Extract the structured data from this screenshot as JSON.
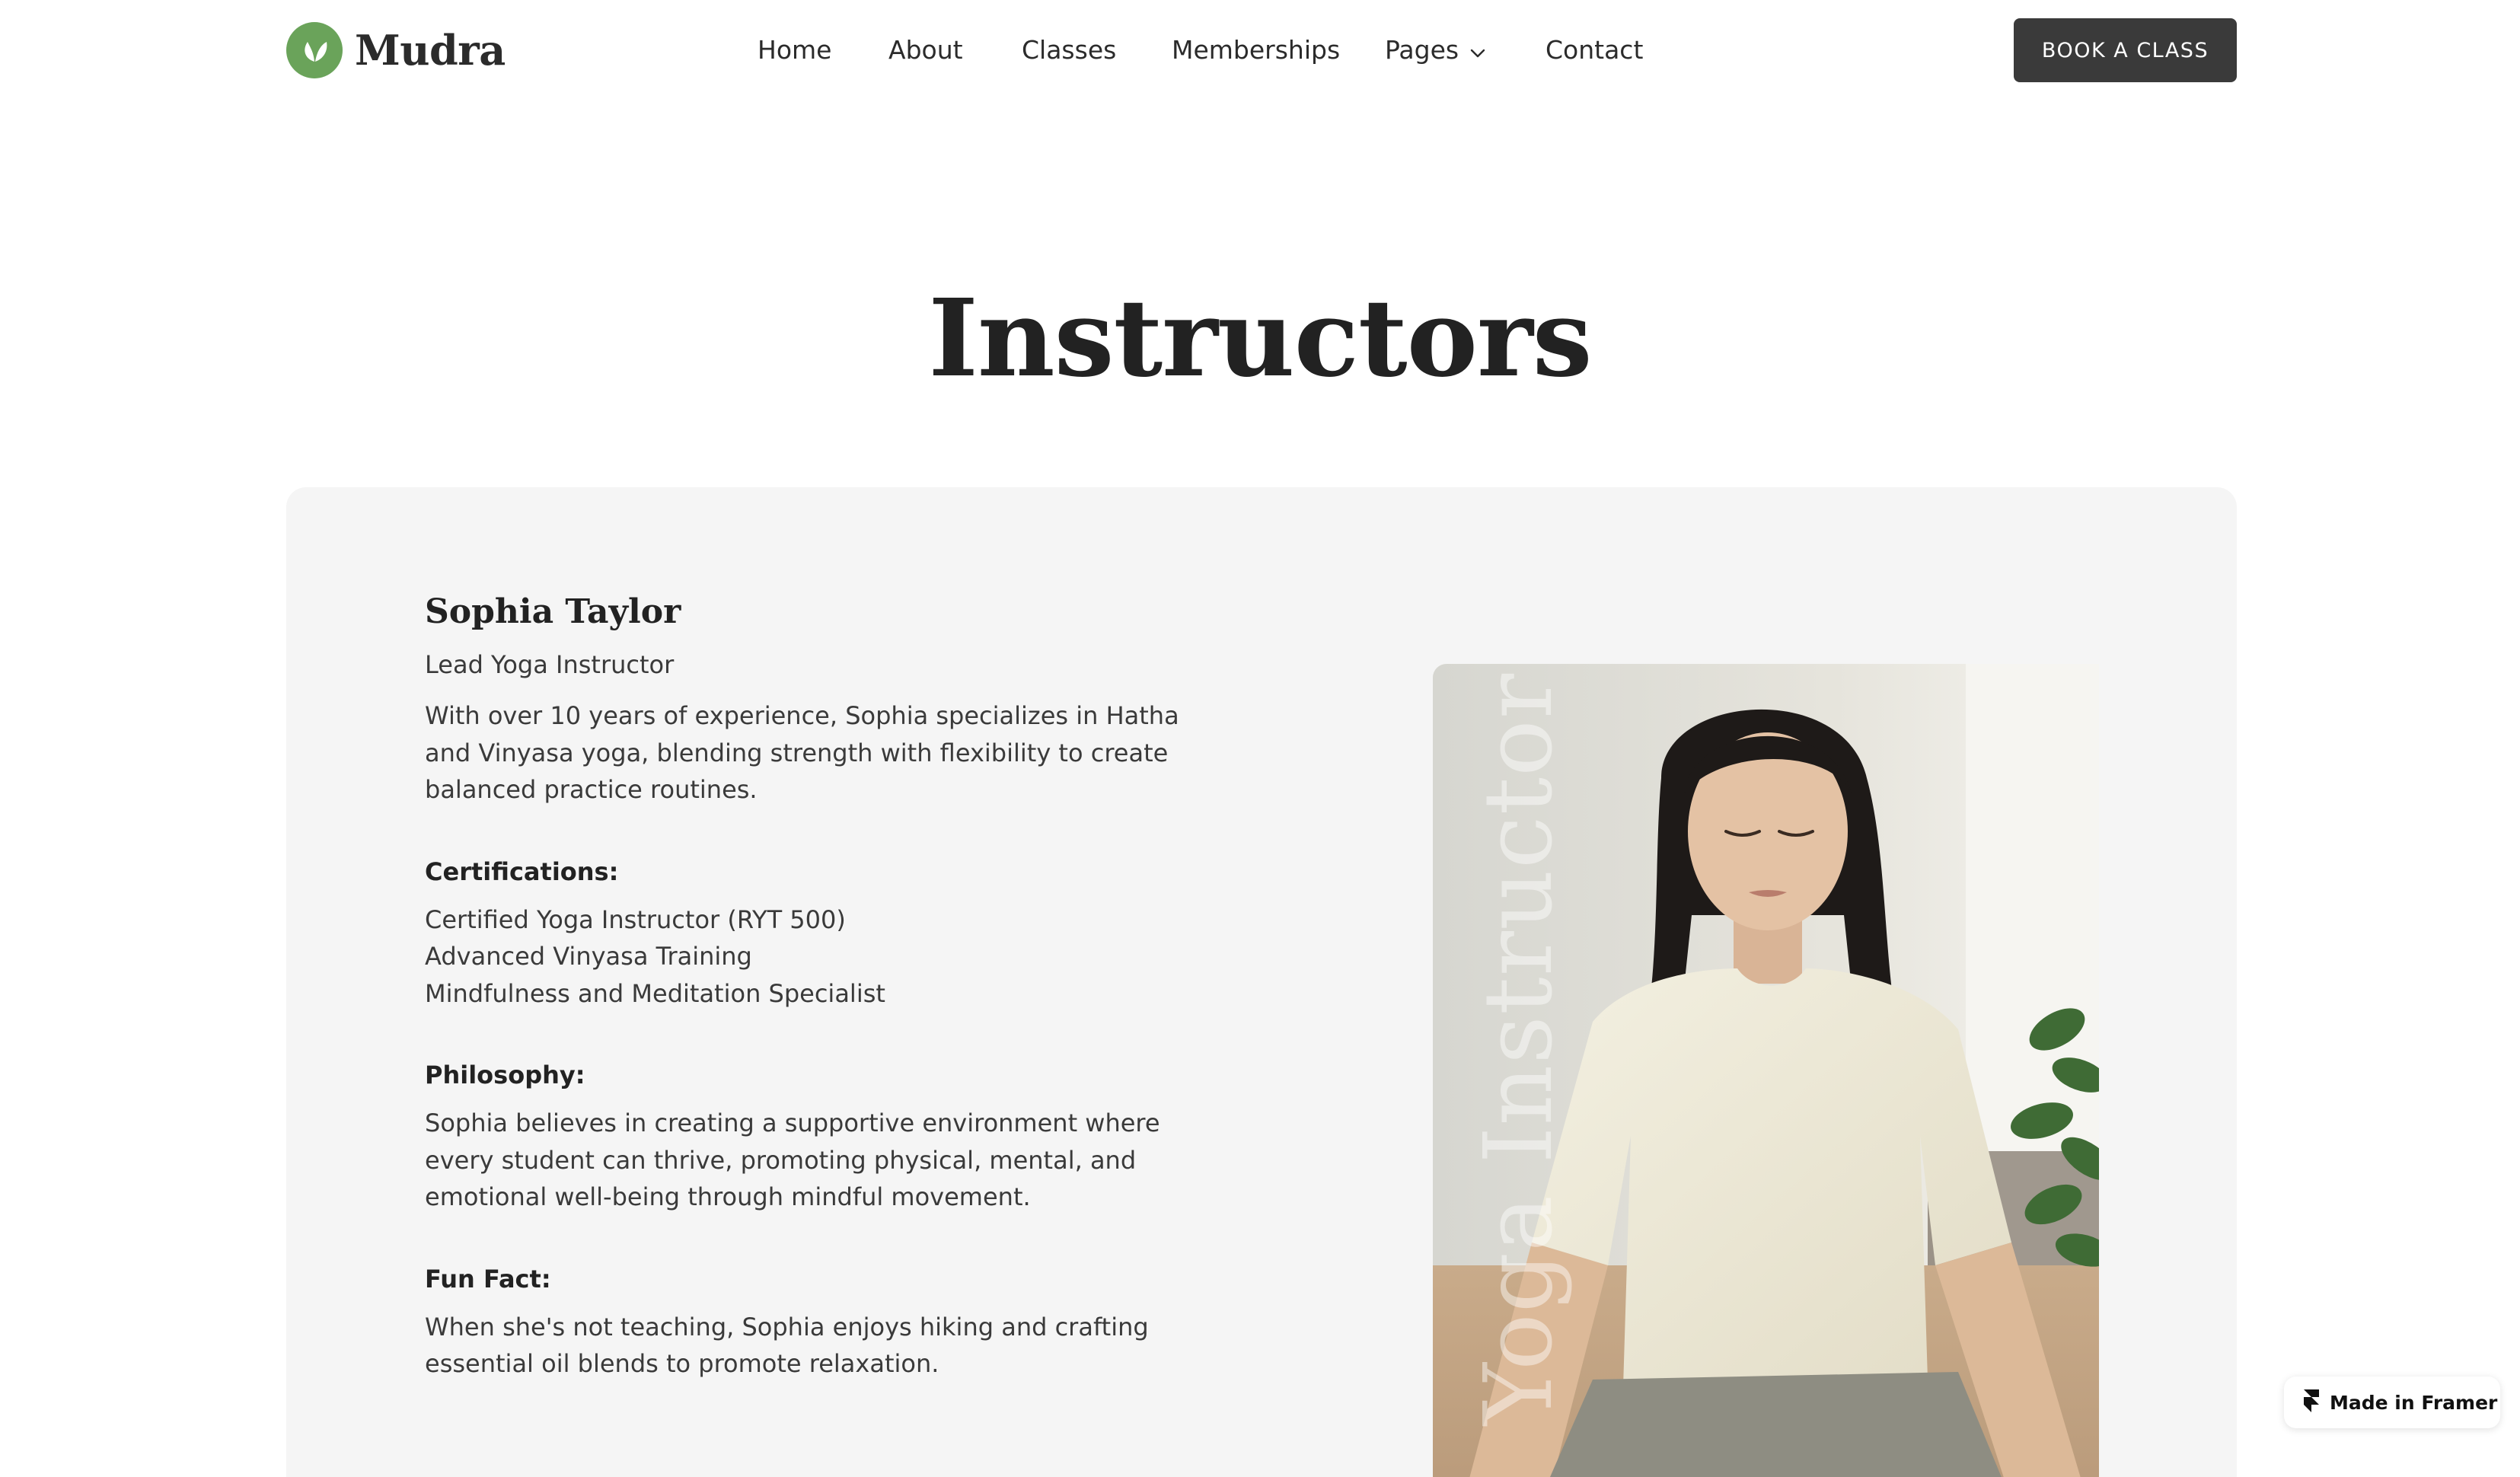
{
  "header": {
    "logo_text": "Mudra",
    "logo_icon": "leaf-icon",
    "nav": [
      {
        "label": "Home"
      },
      {
        "label": "About"
      },
      {
        "label": "Classes"
      },
      {
        "label": "Memberships"
      },
      {
        "label": "Pages",
        "icon": "chevron-down-icon"
      },
      {
        "label": "Contact"
      }
    ],
    "cta_label": "BOOK A CLASS"
  },
  "page": {
    "title": "Instructors"
  },
  "instructor": {
    "name": "Sophia Taylor",
    "role": "Lead Yoga Instructor",
    "bio": "With over 10 years of experience, Sophia specializes in Hatha and Vinyasa yoga, blending strength with flexibility to create balanced practice routines.",
    "certifications_label": "Certifications:",
    "certifications": [
      "Certified Yoga Instructor (RYT 500)",
      "Advanced Vinyasa Training",
      "Mindfulness and Meditation Specialist"
    ],
    "philosophy_label": "Philosophy:",
    "philosophy": "Sophia believes in creating a supportive environment where every student can thrive, promoting physical, mental, and emotional well-being through mindful movement.",
    "fun_fact_label": "Fun Fact:",
    "fun_fact": "When she's not teaching, Sophia enjoys hiking and crafting essential oil blends to promote relaxation.",
    "photo_overlay_text": "Yoga Instructor"
  },
  "badge": {
    "label": "Made in Framer",
    "icon": "framer-logo-icon"
  },
  "colors": {
    "accent_green": "#6aa35a",
    "button_dark": "#3a3a3a",
    "card_bg": "#f5f5f5"
  }
}
